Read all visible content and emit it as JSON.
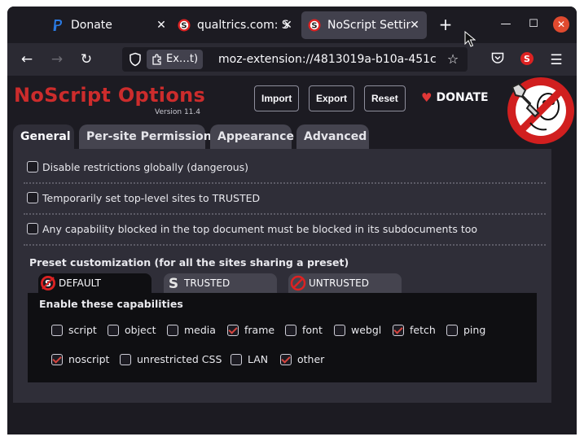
{
  "browser": {
    "tabs": [
      {
        "title": "Donate",
        "icon": "paypal-icon",
        "active": false
      },
      {
        "title": "qualtrics.com: S",
        "icon": "noscript-icon",
        "active": false
      },
      {
        "title": "NoScript Settin",
        "icon": "noscript-icon",
        "active": true
      }
    ],
    "new_tab_label": "+",
    "url_identity": "Ex…t)",
    "url": "moz-extension://4813019a-b10a-451c"
  },
  "header": {
    "title": "NoScript Options",
    "version": "Version 11.4",
    "buttons": {
      "import": "Import",
      "export": "Export",
      "reset": "Reset"
    },
    "donate": "DONATE"
  },
  "tabs": [
    "General",
    "Per-site Permissions",
    "Appearance",
    "Advanced"
  ],
  "general": {
    "options": [
      {
        "label": "Disable restrictions globally (dangerous)",
        "checked": false
      },
      {
        "label": "Temporarily set top-level sites to TRUSTED",
        "checked": false
      },
      {
        "label": "Any capability blocked in the top document must be blocked in its subdocuments too",
        "checked": false
      }
    ],
    "preset_heading": "Preset customization (for all the sites sharing a preset)",
    "presets": [
      "DEFAULT",
      "TRUSTED",
      "UNTRUSTED"
    ],
    "capabilities_heading": "Enable these capabilities",
    "capabilities_row1": [
      {
        "label": "script",
        "checked": false
      },
      {
        "label": "object",
        "checked": false
      },
      {
        "label": "media",
        "checked": false
      },
      {
        "label": "frame",
        "checked": true
      },
      {
        "label": "font",
        "checked": false
      },
      {
        "label": "webgl",
        "checked": false
      },
      {
        "label": "fetch",
        "checked": true
      },
      {
        "label": "ping",
        "checked": false
      }
    ],
    "capabilities_row2": [
      {
        "label": "noscript",
        "checked": true
      },
      {
        "label": "unrestricted CSS",
        "checked": false
      },
      {
        "label": "LAN",
        "checked": false
      },
      {
        "label": "other",
        "checked": true
      }
    ]
  },
  "colors": {
    "accent": "#cc2c2c",
    "check": "#d6453f"
  }
}
